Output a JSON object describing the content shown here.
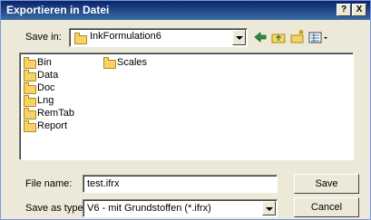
{
  "dialog": {
    "title": "Exportieren in Datei",
    "help_glyph": "?",
    "close_glyph": "X"
  },
  "save_in": {
    "label": "Save in:",
    "value": "InkFormulation6"
  },
  "toolbar": {
    "back_icon": "back-arrow-icon",
    "up_icon": "up-folder-icon",
    "new_folder_icon": "new-folder-icon",
    "view_icon": "view-menu-icon"
  },
  "files": [
    {
      "name": "Bin",
      "icon": "folder-icon"
    },
    {
      "name": "Data",
      "icon": "folder-icon"
    },
    {
      "name": "Doc",
      "icon": "folder-icon"
    },
    {
      "name": "Lng",
      "icon": "folder-icon"
    },
    {
      "name": "RemTab",
      "icon": "folder-icon"
    },
    {
      "name": "Report",
      "icon": "folder-icon"
    },
    {
      "name": "Scales",
      "icon": "folder-icon"
    }
  ],
  "file_name": {
    "label": "File name:",
    "value": "test.ifrx"
  },
  "save_as_type": {
    "label": "Save as type:",
    "value": "V6 - mit Grundstoffen (*.ifrx)"
  },
  "buttons": {
    "save": "Save",
    "cancel": "Cancel"
  },
  "colors": {
    "titlebar": "#0a246a",
    "dialog_bg": "#ece9d8",
    "folder": "#f6d365"
  }
}
